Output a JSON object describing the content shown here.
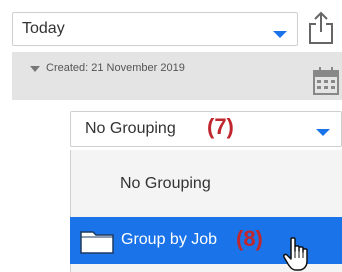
{
  "date_filter": {
    "value": "Today"
  },
  "header": {
    "created_label": "Created: 21 November 2019"
  },
  "grouping": {
    "selected": "No Grouping",
    "step_marker": "(7)",
    "options": [
      {
        "label": "No Grouping",
        "icon": "none"
      },
      {
        "label": "Group by Job",
        "icon": "folder-icon"
      }
    ],
    "highlighted_step_marker": "(8)"
  },
  "icons": {
    "export": "share-export-icon",
    "calendar": "calendar-icon",
    "pointer": "hand-cursor-icon"
  },
  "colors": {
    "accent": "#1a73e8",
    "step_marker": "#c0262d"
  }
}
